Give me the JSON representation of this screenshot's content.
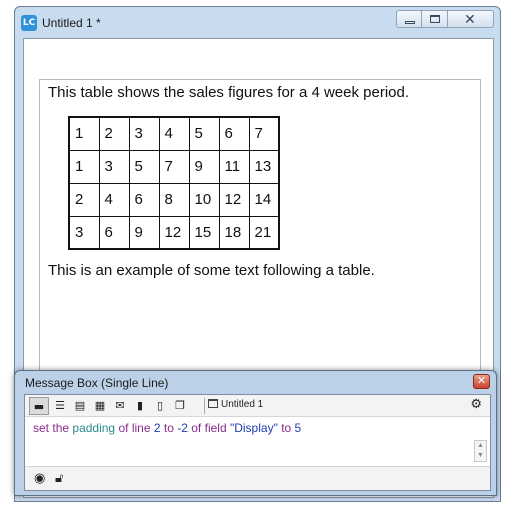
{
  "window": {
    "title": "Untitled 1 *",
    "app_icon_text": "LC"
  },
  "field": {
    "line1": "This table shows the sales figures for a 4 week period.",
    "table": [
      [
        "1",
        "2",
        "3",
        "4",
        "5",
        "6",
        "7"
      ],
      [
        "1",
        "3",
        "5",
        "7",
        "9",
        "11",
        "13"
      ],
      [
        "2",
        "4",
        "6",
        "8",
        "10",
        "12",
        "14"
      ],
      [
        "3",
        "6",
        "9",
        "12",
        "15",
        "18",
        "21"
      ]
    ],
    "line3": "This is an example of some text following a table."
  },
  "message_box": {
    "title": "Message Box (Single Line)",
    "stack_label": "Untitled 1",
    "command": {
      "w1": "set",
      "w2": "the",
      "w3": "padding",
      "w4": "of",
      "w5": "line",
      "w6": "2",
      "w7": "to",
      "w8": "-2",
      "w9": "of",
      "w10": "field",
      "w11": "\"Display\"",
      "w12": "to",
      "w13": "5"
    }
  },
  "colors": {
    "keyword": "#8b2a8f",
    "property": "#2b8b8a",
    "value": "#1d3fb0"
  }
}
